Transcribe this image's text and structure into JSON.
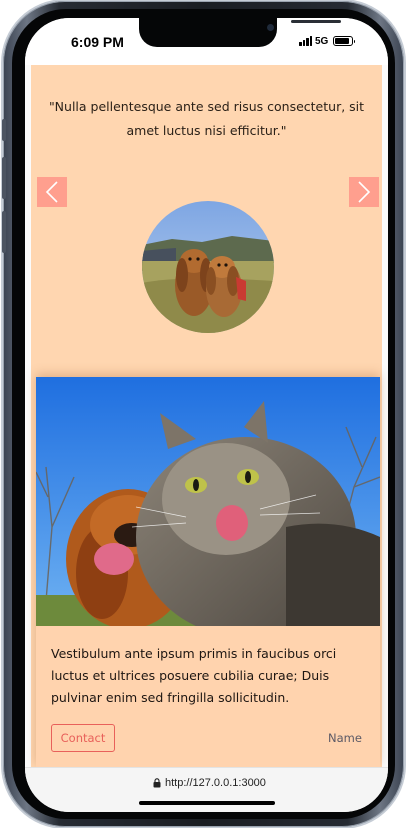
{
  "status_bar": {
    "time": "6:09 PM",
    "network": "5G",
    "battery_level": 0.85
  },
  "testimonial": {
    "quote": "\"Nulla pellentesque ante sed risus consectetur, sit amet luctus nisi efficitur.\"",
    "prev_icon": "chevron-left-icon",
    "next_icon": "chevron-right-icon"
  },
  "card": {
    "text": "Vestibulum ante ipsum primis in faucibus orci luctus et ultrices posuere cubilia curae; Duis pulvinar enim sed fringilla sollicitudin.",
    "contact_label": "Contact",
    "name": "Name"
  },
  "browser": {
    "url": "http://127.0.0.1:3000"
  },
  "colors": {
    "background": "#ffd6b0",
    "nav_button": "#ff9f8e",
    "contact_accent": "#e8605a"
  }
}
